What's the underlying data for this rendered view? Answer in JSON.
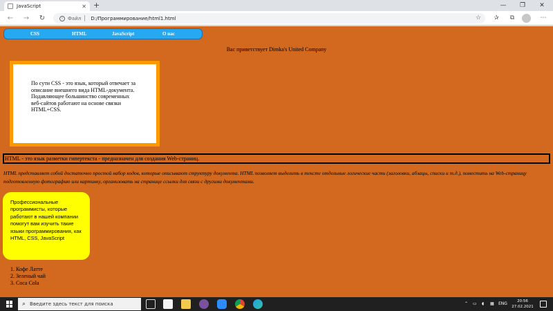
{
  "browser": {
    "tab_title": "JavaScript",
    "tab_close": "✕",
    "new_tab": "+",
    "minimize": "—",
    "maximize": "❐",
    "close": "✕",
    "back": "←",
    "forward": "→",
    "reload": "↻",
    "scheme_label": "Файл",
    "url": "D:/Программирование/html1.html",
    "icons": [
      "favorite-add-icon",
      "favorites-icon",
      "collections-icon",
      "profile-icon",
      "more-icon"
    ]
  },
  "page": {
    "background": "#d2691e",
    "menu": {
      "items": [
        "CSS",
        "HTML",
        "JavaScript",
        "О нас"
      ],
      "background": "#27a9f2"
    },
    "greeting": "Вас приветствует Dimka's United Company",
    "css_box_text": "По сути CSS - это язык, который отвечает за описание внешнего вида HTML-документа. Подавляющее большинство современных веб-сайтов работают на основе связки HTML+CSS.",
    "html_box_text": "HTML - это язык разметки гипертекста - предназначен для создания Web-страниц.",
    "html_italic_text": "HTML представляет собой достаточно простой набор кодов, которые описывают структуру документа. HTML позволяет выделить в тексте отдельные логические части (заголовки, абзацы, списки и т.д.), поместить на Web-страницу подготовленную фотографию или картинку, организовать на странице ссылки для связи с другими документами.",
    "yellow_box_text": "Профессиональные программисты, которые работают в нашей компании помогут вам изучить такие языки программирования, как HTML, CSS, JavaScript",
    "drinks": [
      "1. Кофе Латте",
      "2. Зеленый чай",
      "3. Coca Cola"
    ]
  },
  "taskbar": {
    "search_placeholder": "Введите здесь текст для поиска",
    "apps": [
      "task-view-icon",
      "store-icon",
      "explorer-icon",
      "viber-icon",
      "zoom-icon",
      "chrome-icon",
      "edge-icon"
    ],
    "language": "ENG",
    "time": "20:56",
    "date": "27.02.2021"
  }
}
